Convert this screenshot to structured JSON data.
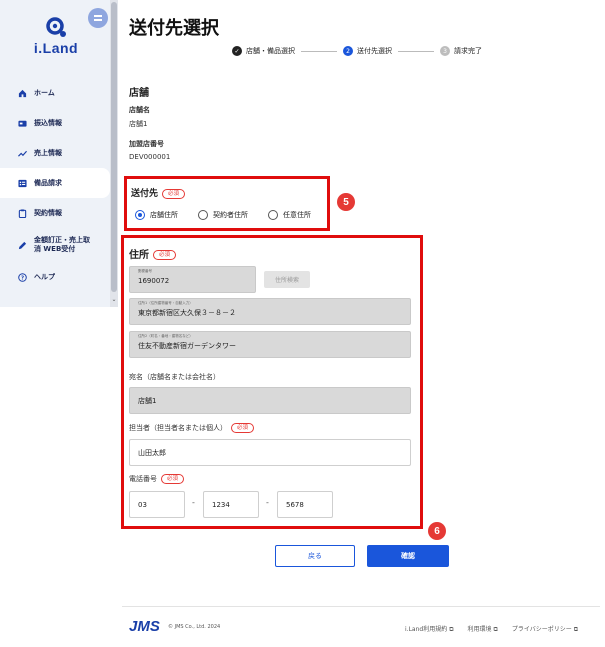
{
  "app": {
    "logo_text": "i.Land"
  },
  "sidebar": {
    "items": [
      {
        "label": "ホーム",
        "icon": "home-icon"
      },
      {
        "label": "振込情報",
        "icon": "card-icon"
      },
      {
        "label": "売上情報",
        "icon": "trend-icon"
      },
      {
        "label": "備品請求",
        "icon": "list-icon"
      },
      {
        "label": "契約情報",
        "icon": "clipboard-icon"
      },
      {
        "label": "金額訂正・売上取消 WEB受付",
        "icon": "pencil-icon"
      },
      {
        "label": "ヘルプ",
        "icon": "help-icon"
      }
    ],
    "active_index": 3
  },
  "page": {
    "title": "送付先選択"
  },
  "stepper": {
    "steps": [
      {
        "label": "店舗・備品選択",
        "state": "done"
      },
      {
        "label": "送付先選択",
        "state": "current",
        "num": "2"
      },
      {
        "label": "請求完了",
        "state": "todo",
        "num": "3"
      }
    ]
  },
  "store": {
    "section_title": "店舗",
    "name_label": "店舗名",
    "name_value": "店舗1",
    "member_label": "加盟店番号",
    "member_value": "DEV000001"
  },
  "destination": {
    "title": "送付先",
    "required": "必須",
    "options": [
      "店舗住所",
      "契約者住所",
      "任意住所"
    ],
    "selected": 0
  },
  "address": {
    "title": "住所",
    "required": "必須",
    "postal_label": "郵便番号",
    "postal_value": "1690072",
    "search_button": "住所検索",
    "addr1_label": "住所1（住所建物番号・自動入力）",
    "addr1_value": "東京都新宿区大久保３－８－２",
    "addr2_label": "住所2（町名・番地・建物名など）",
    "addr2_value": "住友不動産新宿ガーデンタワー",
    "recipient_label": "宛名（店舗名または会社名）",
    "recipient_value": "店舗1",
    "contact_label": "担当者（担当者名または個人）",
    "contact_required": "必須",
    "contact_value": "山田太郎",
    "phone_label": "電話番号",
    "phone_required": "必須",
    "phone1": "03",
    "phone2": "1234",
    "phone3": "5678",
    "dash": "-"
  },
  "annotations": {
    "badge5": "5",
    "badge6": "6"
  },
  "actions": {
    "back": "戻る",
    "confirm": "確認"
  },
  "footer": {
    "logo": "JMS",
    "copyright": "© JMS Co., Ltd. 2024",
    "links": [
      "i.Land利用規約",
      "利用環境",
      "プライバシーポリシー"
    ]
  },
  "colors": {
    "brand": "#1a3fa8",
    "primary": "#1a56db",
    "highlight": "#e00d0d"
  }
}
